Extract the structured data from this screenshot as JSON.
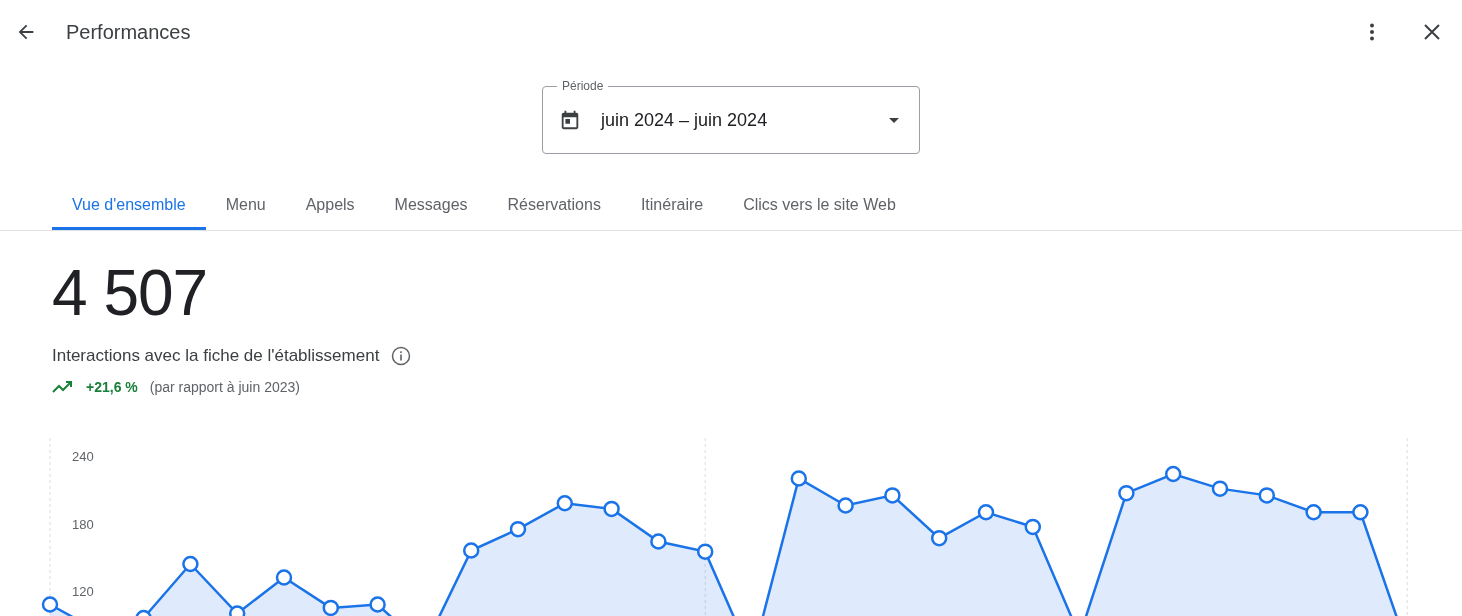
{
  "header": {
    "title": "Performances"
  },
  "period": {
    "label": "Période",
    "value": "juin 2024 – juin 2024"
  },
  "tabs": [
    {
      "label": "Vue d'ensemble",
      "selected": true
    },
    {
      "label": "Menu",
      "selected": false
    },
    {
      "label": "Appels",
      "selected": false
    },
    {
      "label": "Messages",
      "selected": false
    },
    {
      "label": "Réservations",
      "selected": false
    },
    {
      "label": "Itinéraire",
      "selected": false
    },
    {
      "label": "Clics vers le site Web",
      "selected": false
    }
  ],
  "summary": {
    "total": "4 507",
    "label": "Interactions avec la fiche de l'établissement",
    "change": "+21,6 %",
    "comparison": "(par rapport à juin 2023)",
    "increase": true
  },
  "chart_data": {
    "type": "area",
    "grid": true,
    "ylim": [
      0,
      240
    ],
    "yticks": [
      120,
      180,
      240
    ],
    "series": [
      {
        "color": "#1a73e8",
        "values": [
          108,
          85,
          96,
          144,
          100,
          132,
          105,
          108,
          70,
          156,
          175,
          198,
          193,
          164,
          155,
          60,
          220,
          196,
          205,
          167,
          190,
          177,
          80,
          207,
          224,
          211,
          205,
          190,
          190,
          70
        ]
      }
    ]
  }
}
